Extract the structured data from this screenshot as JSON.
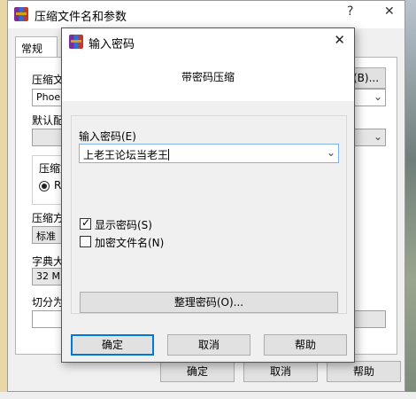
{
  "main_window": {
    "title": "压缩文件名和参数",
    "help_button": "?",
    "close_button": "✕",
    "tab_general": "常规",
    "label_archive_name": "压缩文",
    "archive_name_value": "Phoeni",
    "browse_button": "(B)...",
    "label_default_profile": "默认配",
    "label_format": "压缩文",
    "format_option": "RA",
    "label_method": "压缩方",
    "method_value": "标准",
    "label_dictionary": "字典大",
    "dictionary_value": "32 MB",
    "label_split": "切分为",
    "ok_button": "确定",
    "cancel_button": "取消",
    "help_label": "帮助"
  },
  "dialog": {
    "title": "输入密码",
    "close_button": "✕",
    "heading": "带密码压缩",
    "password_label": "输入密码(E)",
    "password_value": "上老王论坛当老王",
    "show_password": {
      "label": "显示密码(S)",
      "checked": true
    },
    "encrypt_names": {
      "label": "加密文件名(N)",
      "checked": false
    },
    "organize_button": "整理密码(O)...",
    "ok_button": "确定",
    "cancel_button": "取消",
    "help_button": "帮助"
  },
  "colors": {
    "focus_border": "#0078d7",
    "input_focus": "#7eb4ea",
    "dialog_bg": "#f0f0f0"
  }
}
